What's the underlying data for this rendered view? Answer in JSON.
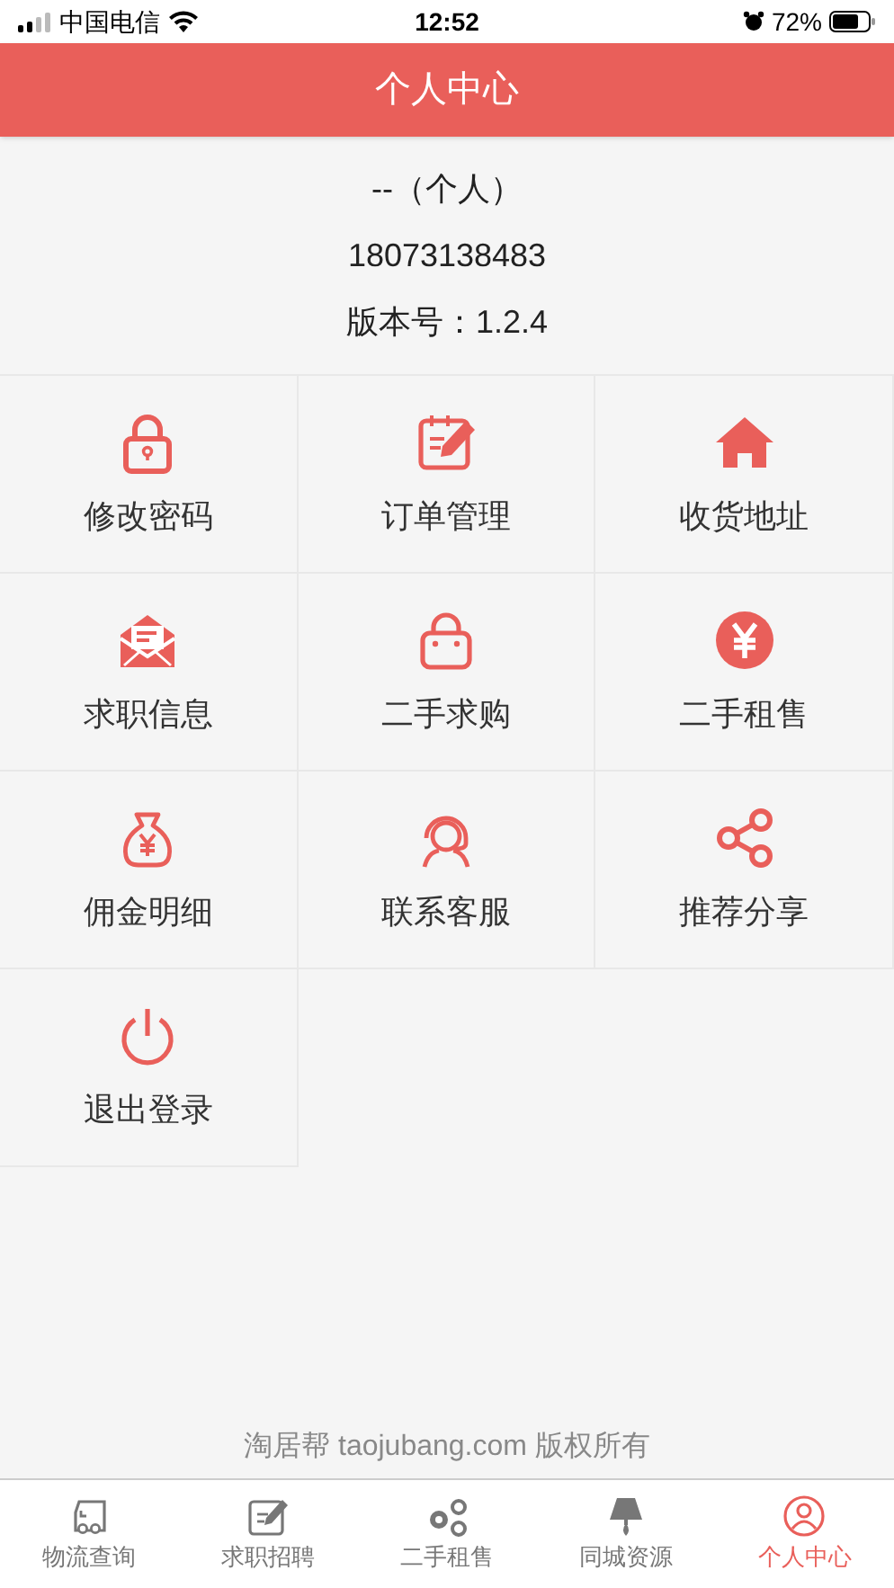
{
  "status_bar": {
    "carrier": "中国电信",
    "time": "12:52",
    "battery": "72%"
  },
  "header": {
    "title": "个人中心"
  },
  "profile": {
    "name": "--（个人）",
    "phone": "18073138483",
    "version": "版本号：1.2.4"
  },
  "menu": [
    {
      "label": "修改密码"
    },
    {
      "label": "订单管理"
    },
    {
      "label": "收货地址"
    },
    {
      "label": "求职信息"
    },
    {
      "label": "二手求购"
    },
    {
      "label": "二手租售"
    },
    {
      "label": "佣金明细"
    },
    {
      "label": "联系客服"
    },
    {
      "label": "推荐分享"
    },
    {
      "label": "退出登录"
    }
  ],
  "footer": {
    "copyright": "淘居帮 taojubang.com 版权所有"
  },
  "tab_bar": [
    {
      "label": "物流查询",
      "selected": false
    },
    {
      "label": "求职招聘",
      "selected": false
    },
    {
      "label": "二手租售",
      "selected": false
    },
    {
      "label": "同城资源",
      "selected": false
    },
    {
      "label": "个人中心",
      "selected": true
    }
  ]
}
